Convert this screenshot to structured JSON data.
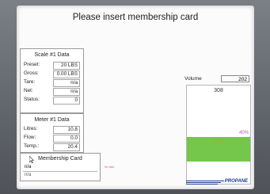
{
  "title": "Please insert membership card",
  "scale": {
    "title": "Scale #1 Data",
    "rows": [
      {
        "label": "Preset:",
        "value": "20 LBS"
      },
      {
        "label": "Gross:",
        "value": "0.00 LBS"
      },
      {
        "label": "Tare:",
        "value": "n/a"
      },
      {
        "label": "Net:",
        "value": "n/a"
      },
      {
        "label": "Status:",
        "value": "0"
      }
    ]
  },
  "meter": {
    "title": "Meter #1 Data",
    "rows": [
      {
        "label": "Litres:",
        "value": "10.8"
      },
      {
        "label": "Flow:",
        "value": "0.0"
      },
      {
        "label": "Temp.:",
        "value": "20.4"
      }
    ]
  },
  "membership": {
    "title": "Membership Card",
    "line1": "n/a",
    "line2": "n/a"
  },
  "volume": {
    "label": "Volume",
    "value": "202",
    "tank_top": "308",
    "fill_value": "202",
    "percent_label": "40%",
    "fill_fraction": 0.4
  },
  "brand": "PROPANE",
  "note": "No data",
  "colors": {
    "tank_fill": "#74c74a",
    "brand": "#1a3d8f",
    "percent": "#b260b2"
  }
}
